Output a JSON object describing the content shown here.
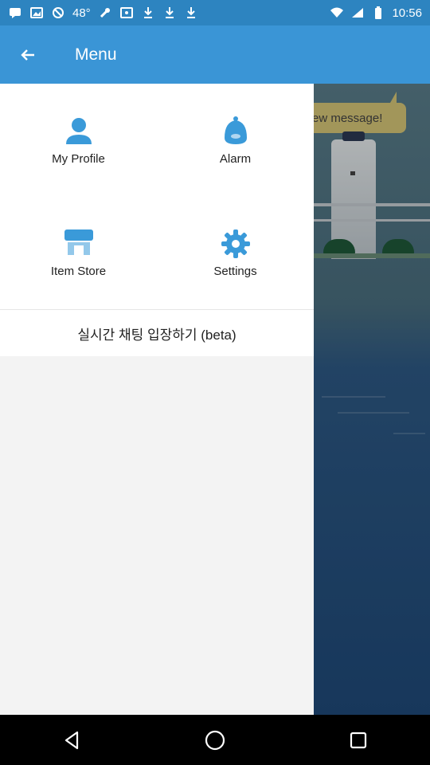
{
  "status_bar": {
    "time": "10:56",
    "left_icons": [
      "message-icon",
      "image-icon",
      "sync-icon",
      "weather-icon",
      "wrench-icon",
      "photo-icon",
      "download-icon",
      "download-icon",
      "download-icon"
    ],
    "temperature": "48°",
    "right_icons": [
      "wifi-icon",
      "signal-icon",
      "battery-icon"
    ]
  },
  "app_bar": {
    "title": "Menu",
    "back_icon": "arrow-back-icon",
    "color": "#3a95d6"
  },
  "background": {
    "speech_text": "ew message!"
  },
  "menu": {
    "items": [
      {
        "label": "My Profile",
        "icon": "person-icon"
      },
      {
        "label": "Alarm",
        "icon": "bell-icon"
      },
      {
        "label": "Item Store",
        "icon": "store-icon"
      },
      {
        "label": "Settings",
        "icon": "gear-icon"
      }
    ],
    "beta_label": "실시간 채팅 입장하기 (beta)"
  },
  "nav_bar": {
    "buttons": [
      "back-triangle-icon",
      "home-circle-icon",
      "recents-square-icon"
    ]
  },
  "colors": {
    "accent": "#3a95d6",
    "status_bar": "#2d84c0",
    "icon_blue": "#3a9ad9"
  }
}
